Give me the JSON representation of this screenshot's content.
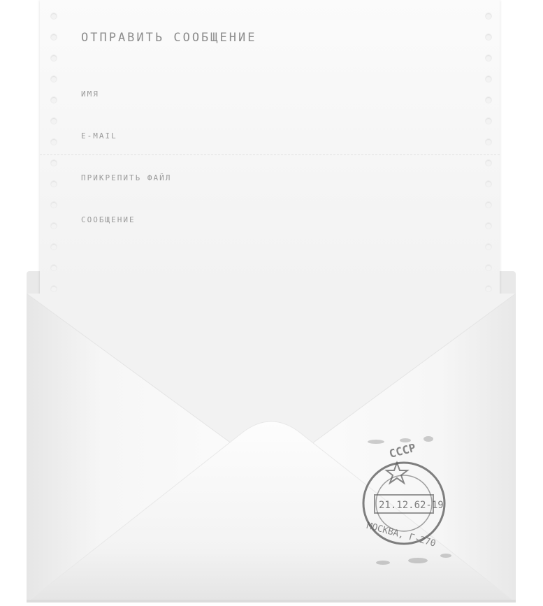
{
  "form": {
    "title": "Отправить сообщение",
    "fields": {
      "name_label": "имя",
      "name_value": "",
      "email_label": "e-mail",
      "email_value": "",
      "attach_label": "прикрепить файл",
      "message_label": "сообщение",
      "message_value": ""
    }
  },
  "stamp": {
    "country": "СССР",
    "date": "21.12.62-19",
    "city": "МОСКВА, Г-270"
  },
  "colors": {
    "paper": "#f6f6f6",
    "envelope": "#f4f4f4",
    "text": "#8d8d8d",
    "stamp_ink": "#555555"
  }
}
